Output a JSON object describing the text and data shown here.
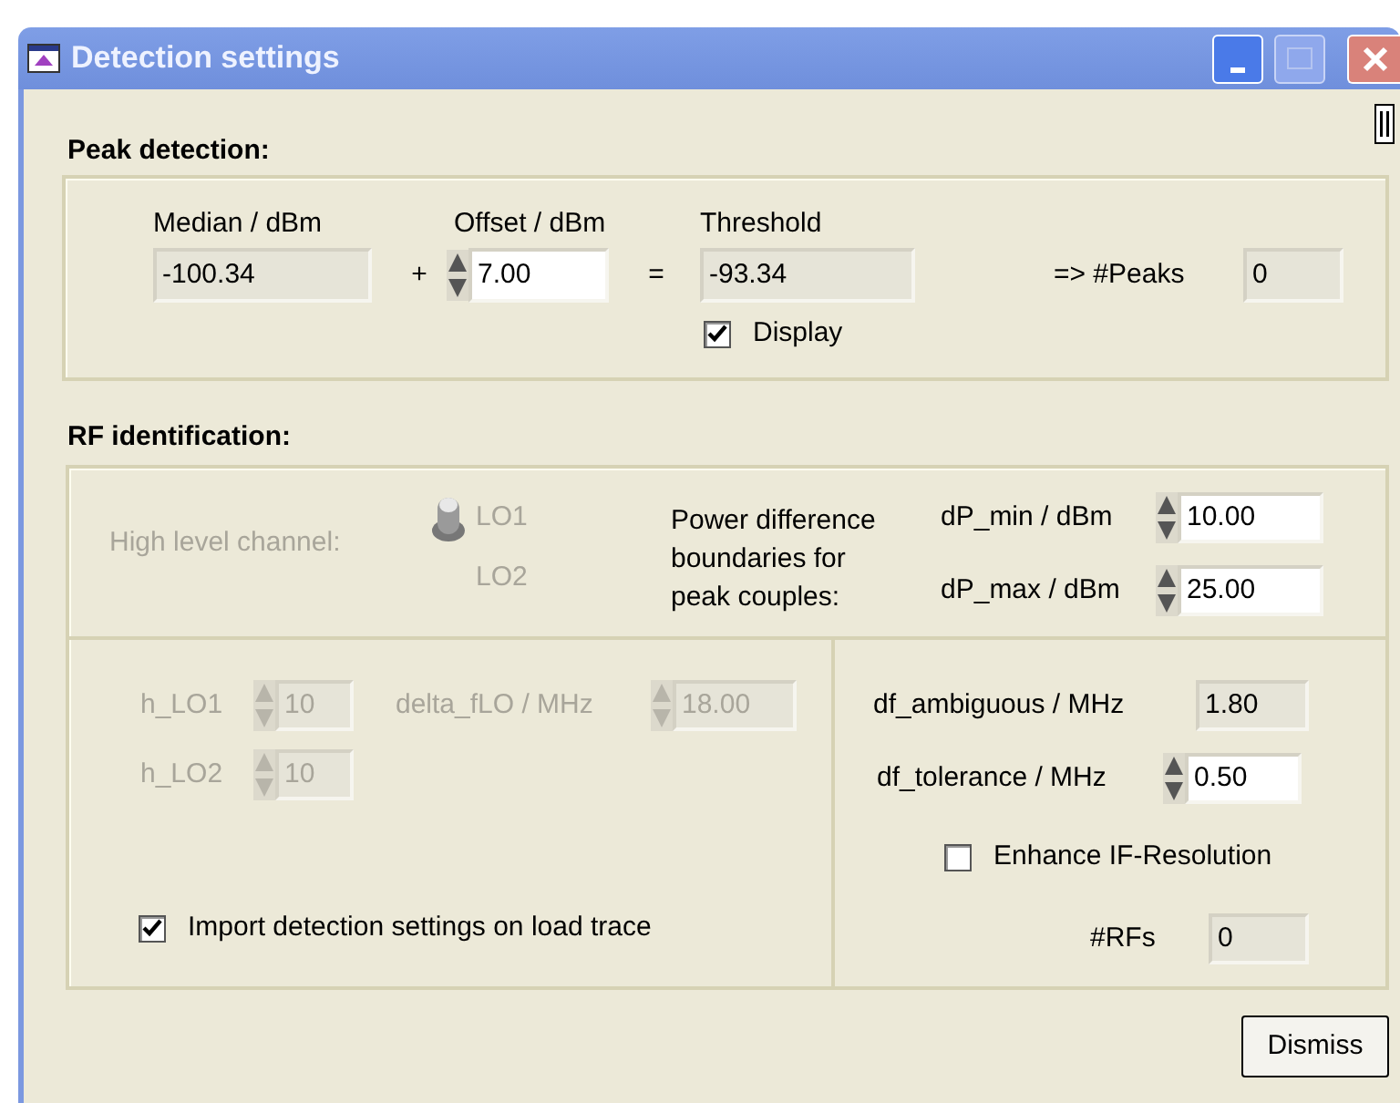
{
  "window": {
    "title": "Detection settings"
  },
  "peak_detection": {
    "title": "Peak detection:",
    "median": {
      "label": "Median / dBm",
      "value": "-100.34",
      "kind": "indicator"
    },
    "plus": "+",
    "offset": {
      "label": "Offset / dBm",
      "value": "7.00",
      "kind": "control"
    },
    "equals": "=",
    "threshold": {
      "label": "Threshold",
      "value": "-93.34",
      "kind": "indicator"
    },
    "display": {
      "label": "Display",
      "checked": true
    },
    "peaks": {
      "label": "=> #Peaks",
      "value": "0",
      "kind": "indicator"
    }
  },
  "rf_identification": {
    "title": "RF identification:",
    "high_level_channel": {
      "label": "High level channel:",
      "disabled": true,
      "switch_up": true,
      "options": [
        {
          "label": "LO1"
        },
        {
          "label": "LO2"
        }
      ]
    },
    "power_difference": {
      "lines": [
        "Power difference",
        "boundaries for",
        "peak couples:"
      ],
      "dp_min": {
        "label": "dP_min / dBm",
        "value": "10.00",
        "kind": "control"
      },
      "dp_max": {
        "label": "dP_max / dBm",
        "value": "25.00",
        "kind": "control"
      }
    },
    "h_lo1": {
      "label": "h_LO1",
      "value": "10",
      "kind": "control",
      "disabled": true
    },
    "delta_flo": {
      "label": "delta_fLO / MHz",
      "value": "18.00",
      "kind": "control",
      "disabled": true
    },
    "h_lo2": {
      "label": "h_LO2",
      "value": "10",
      "kind": "control",
      "disabled": true
    },
    "import_settings": {
      "label": "Import detection settings on load trace",
      "checked": true
    },
    "df_ambiguous": {
      "label": "df_ambiguous / MHz",
      "value": "1.80",
      "kind": "indicator"
    },
    "df_tolerance": {
      "label": "df_tolerance / MHz",
      "value": "0.50",
      "kind": "control"
    },
    "enhance_if": {
      "label": "Enhance IF-Resolution",
      "checked": false
    },
    "rfs": {
      "label": "#RFs",
      "value": "0",
      "kind": "indicator"
    }
  },
  "dismiss": "Dismiss"
}
